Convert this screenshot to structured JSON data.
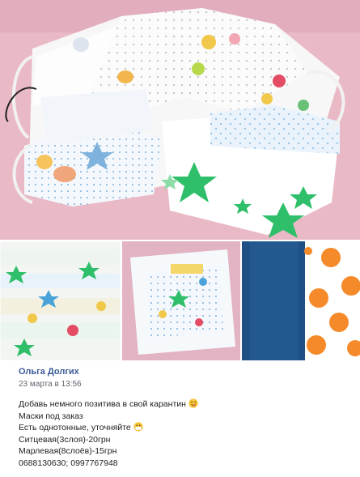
{
  "post": {
    "author": "Ольга Долгих",
    "timestamp": "23 марта в 13:56",
    "lines": [
      "Добавь немного позитива в свой карантин",
      "Маски под заказ",
      "Есть однотонные, уточняйте",
      "Ситцевая(3слоя)-20грн",
      "Марлевая(8слоёв)-15грн",
      "0688130630; 0997767948"
    ],
    "emojis": [
      "winking-face-tongue-icon",
      "medical-mask-face-icon"
    ]
  },
  "photos": {
    "count": 4,
    "main": "fabric-masks-fan-photo",
    "thumbnails": [
      "masks-stack-photo",
      "masks-pile-photo",
      "blue-and-polka-dot-fabric-photo"
    ]
  },
  "colors": {
    "author_link": "#385898",
    "timestamp": "#616770",
    "text": "#1c1e21",
    "background_pink": "#e9b9c6",
    "star_green": "#2fbf6a",
    "polka_orange": "#f58a2a",
    "solid_blue": "#1e4f85"
  }
}
